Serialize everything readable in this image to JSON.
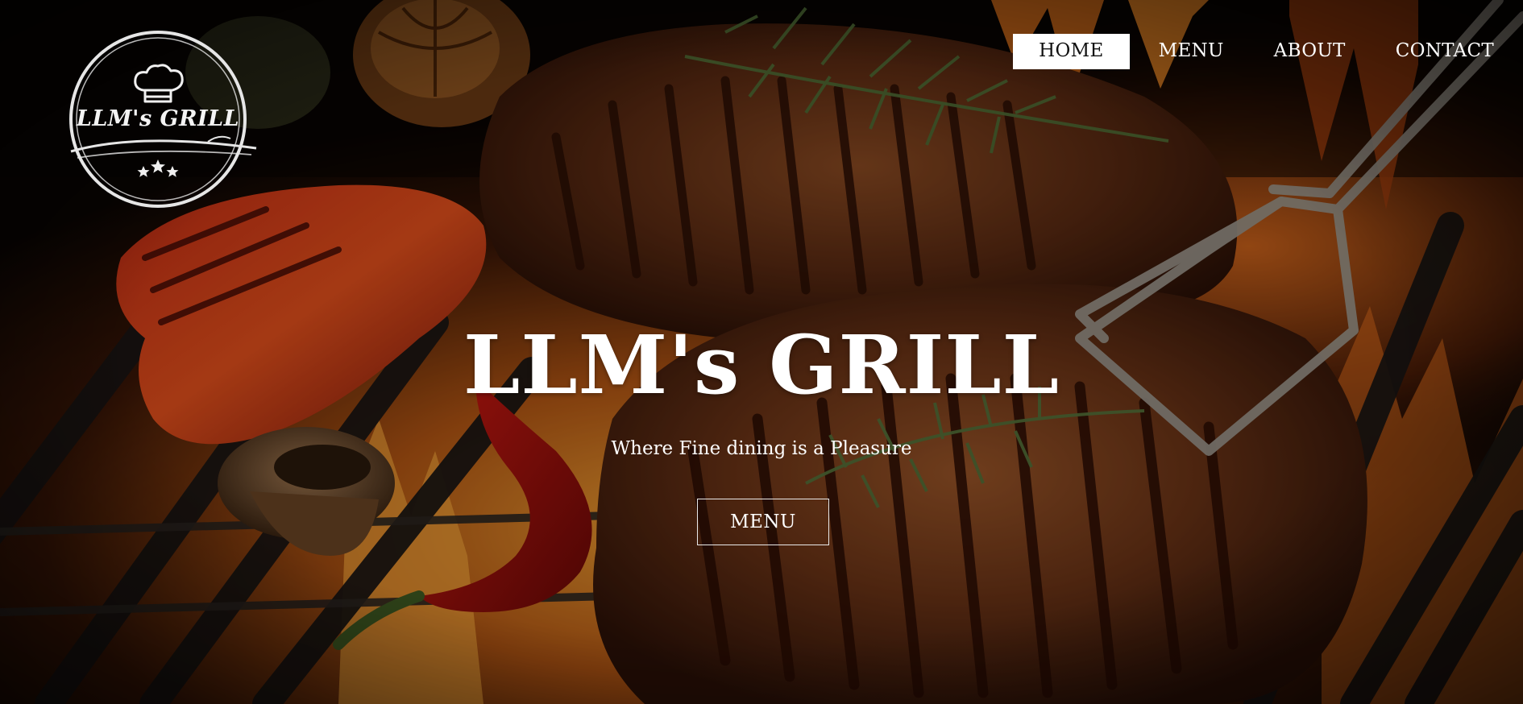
{
  "site": {
    "logo": {
      "text": "LLM's GRILL",
      "icon": "chef-hat-icon",
      "stars": 3
    }
  },
  "nav": {
    "items": [
      {
        "label": "HOME",
        "active": true
      },
      {
        "label": "MENU",
        "active": false
      },
      {
        "label": "ABOUT",
        "active": false
      },
      {
        "label": "CONTACT",
        "active": false
      }
    ]
  },
  "hero": {
    "title": "LLM's GRILL",
    "subtitle": "Where Fine dining is a Pleasure",
    "button_label": "MENU"
  },
  "colors": {
    "text": "#ffffff",
    "nav_active_bg": "#ffffff",
    "nav_active_text": "#111111",
    "overlay": "#000000"
  }
}
